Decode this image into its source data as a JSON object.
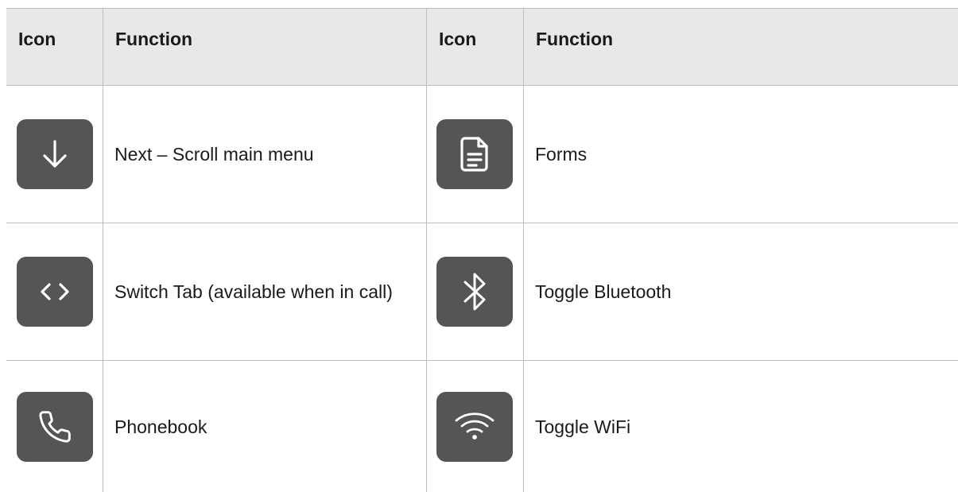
{
  "headers": [
    "Icon",
    "Function",
    "Icon",
    "Function"
  ],
  "rows": [
    {
      "left": {
        "icon": "arrow-down-icon",
        "label": "Next – Scroll main menu"
      },
      "right": {
        "icon": "document-icon",
        "label": "Forms"
      }
    },
    {
      "left": {
        "icon": "switch-tab-icon",
        "label": "Switch Tab (available when in call)"
      },
      "right": {
        "icon": "bluetooth-icon",
        "label": "Toggle Bluetooth"
      }
    },
    {
      "left": {
        "icon": "phone-icon",
        "label": "Phonebook"
      },
      "right": {
        "icon": "wifi-icon",
        "label": "Toggle WiFi"
      }
    }
  ],
  "colors": {
    "icon_bg": "#555555",
    "header_bg": "#e8e8e8",
    "grid": "#bfbfbf"
  }
}
